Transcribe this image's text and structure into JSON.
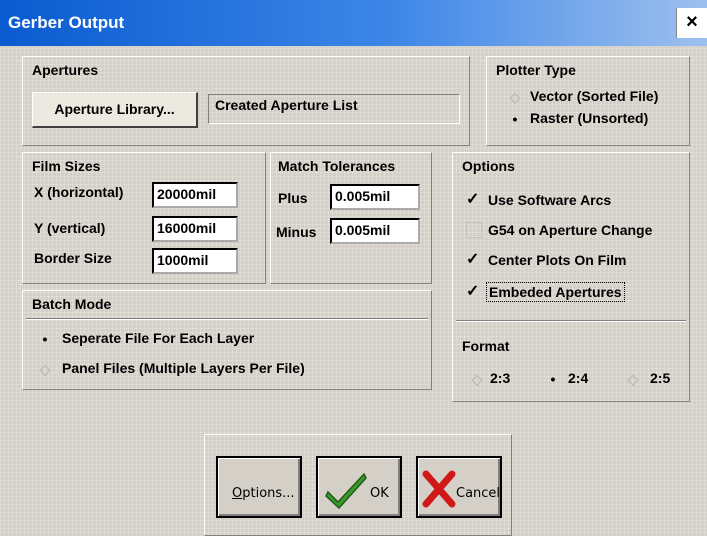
{
  "window": {
    "title": "Gerber Output",
    "close_label": "×"
  },
  "apertures": {
    "label": "Apertures",
    "library_button": "Aperture Library...",
    "list_field": "Created Aperture List"
  },
  "plotter": {
    "label": "Plotter Type",
    "options": [
      {
        "label": "Vector (Sorted File)",
        "selected": false
      },
      {
        "label": "Raster (Unsorted)",
        "selected": true
      }
    ]
  },
  "film": {
    "label": "Film Sizes",
    "x_label": "X (horizontal)",
    "x_value": "20000mil",
    "y_label": "Y (vertical)",
    "y_value": "16000mil",
    "border_label": "Border Size",
    "border_value": "1000mil"
  },
  "match": {
    "label": "Match Tolerances",
    "plus_label": "Plus",
    "plus_value": "0.005mil",
    "minus_label": "Minus",
    "minus_value": "0.005mil"
  },
  "options": {
    "label": "Options",
    "items": [
      {
        "label": "Use Software Arcs",
        "checked": true
      },
      {
        "label": "G54 on Aperture Change",
        "checked": false
      },
      {
        "label": "Center Plots On Film",
        "checked": true
      },
      {
        "label": "Embeded Apertures",
        "checked": true
      }
    ],
    "format_label": "Format",
    "formats": [
      {
        "label": "2:3",
        "selected": false
      },
      {
        "label": "2:4",
        "selected": true
      },
      {
        "label": "2:5",
        "selected": false
      }
    ]
  },
  "batch": {
    "label": "Batch Mode",
    "options": [
      {
        "label": "Seperate File For Each Layer",
        "selected": true
      },
      {
        "label": "Panel Files (Multiple Layers Per File)",
        "selected": false
      }
    ]
  },
  "buttons": {
    "options_prefix": "O",
    "options_rest": "ptions...",
    "ok": "OK",
    "cancel": "Cancel"
  },
  "colors": {
    "accent": "#0a5bd0",
    "ok_check": "#3a9a2a",
    "cancel_x": "#d01818"
  }
}
